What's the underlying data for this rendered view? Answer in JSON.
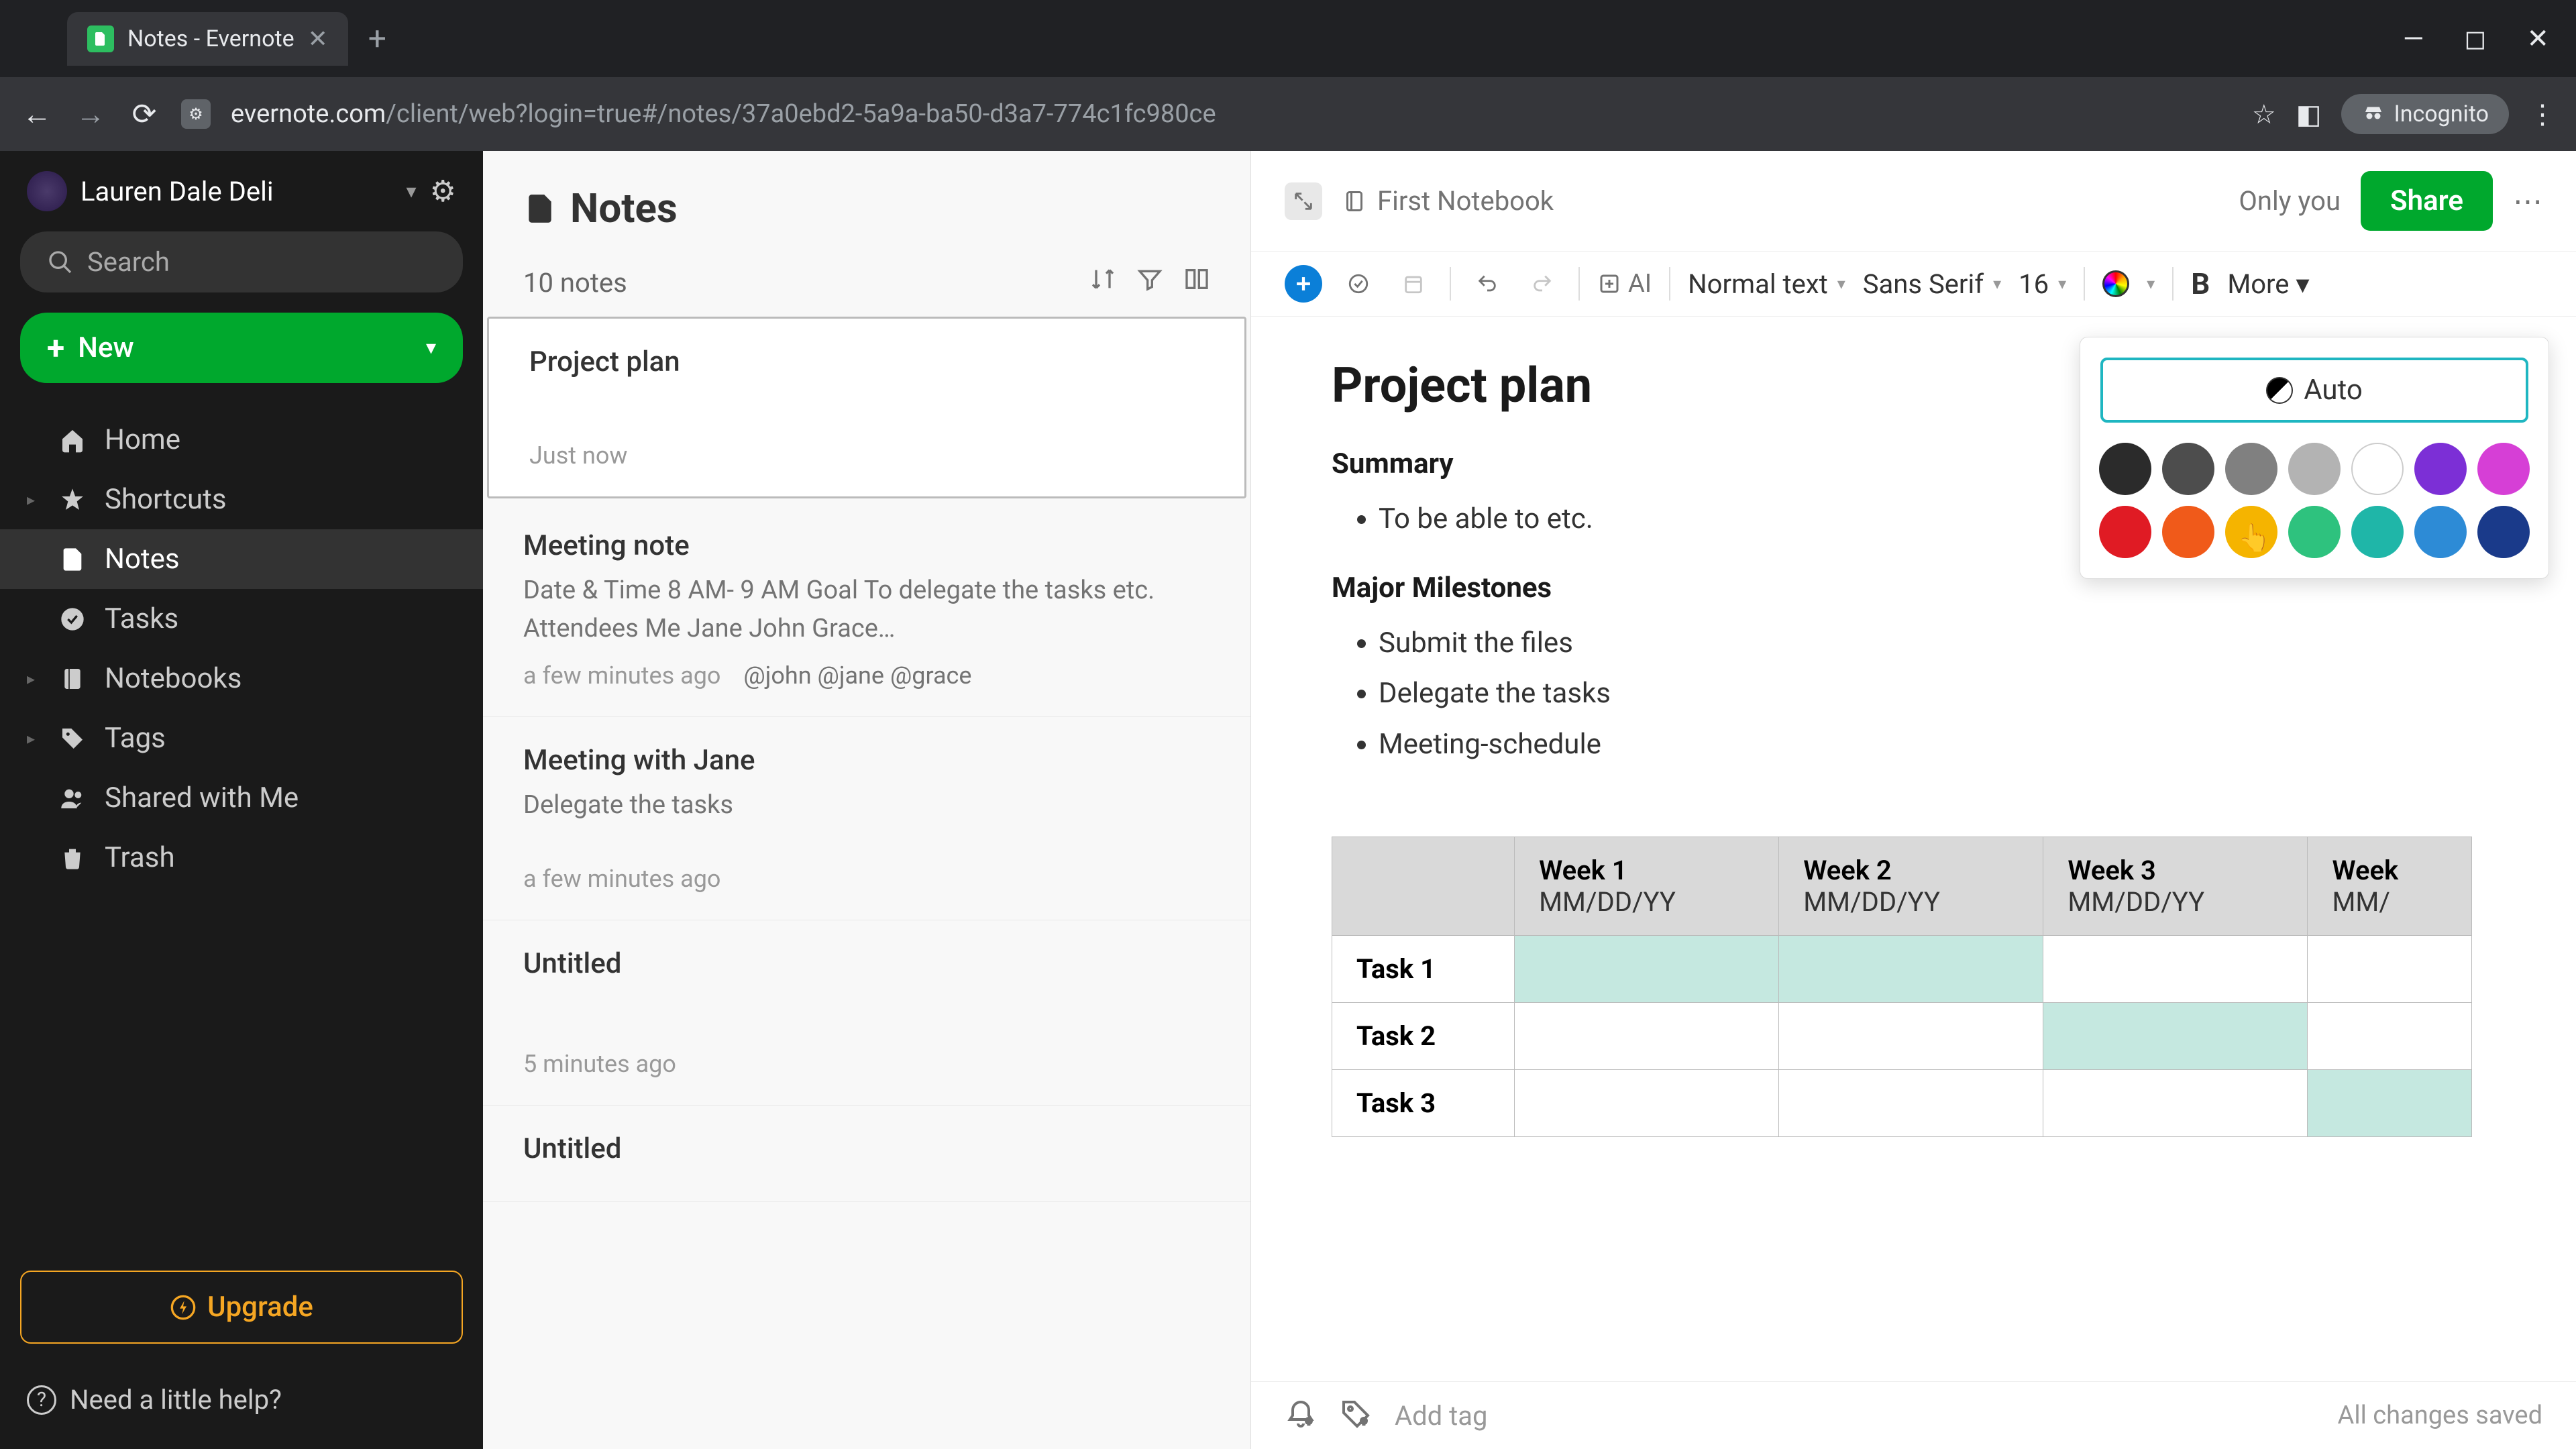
{
  "browser": {
    "tab_title": "Notes - Evernote",
    "url_domain": "evernote.com",
    "url_path": "/client/web?login=true#/notes/37a0ebd2-5a9a-ba50-d3a7-774c1fc980ce",
    "incognito_label": "Incognito"
  },
  "sidebar": {
    "account_name": "Lauren Dale Deli",
    "search_placeholder": "Search",
    "new_label": "New",
    "items": [
      {
        "label": "Home"
      },
      {
        "label": "Shortcuts"
      },
      {
        "label": "Notes"
      },
      {
        "label": "Tasks"
      },
      {
        "label": "Notebooks"
      },
      {
        "label": "Tags"
      },
      {
        "label": "Shared with Me"
      },
      {
        "label": "Trash"
      }
    ],
    "upgrade_label": "Upgrade",
    "help_label": "Need a little help?"
  },
  "note_list": {
    "title": "Notes",
    "count_label": "10 notes",
    "items": [
      {
        "title": "Project plan",
        "preview": "",
        "time": "Just now",
        "mentions": ""
      },
      {
        "title": "Meeting note",
        "preview": "Date & Time 8 AM- 9 AM Goal To delegate the tasks etc. Attendees Me Jane John Grace…",
        "time": "a few minutes ago",
        "mentions": "@john @jane @grace"
      },
      {
        "title": "Meeting with Jane",
        "preview": "Delegate the tasks",
        "time": "a few minutes ago",
        "mentions": ""
      },
      {
        "title": "Untitled",
        "preview": "",
        "time": "5 minutes ago",
        "mentions": ""
      },
      {
        "title": "Untitled",
        "preview": "",
        "time": "",
        "mentions": ""
      }
    ]
  },
  "editor": {
    "notebook_label": "First Notebook",
    "only_you_label": "Only you",
    "share_label": "Share",
    "toolbar": {
      "ai_label": "AI",
      "style_label": "Normal text",
      "font_label": "Sans Serif",
      "size_label": "16",
      "more_label": "More"
    },
    "document": {
      "title": "Project plan",
      "sections": [
        {
          "heading": "Summary",
          "bullets": [
            "To be able to etc."
          ]
        },
        {
          "heading": "Major Milestones",
          "bullets": [
            "Submit the files",
            "Delegate the tasks",
            "Meeting-schedule"
          ]
        }
      ],
      "table": {
        "headers": [
          {
            "label": "Week 1",
            "sub": "MM/DD/YY"
          },
          {
            "label": "Week 2",
            "sub": "MM/DD/YY"
          },
          {
            "label": "Week 3",
            "sub": "MM/DD/YY"
          },
          {
            "label": "Week",
            "sub": "MM/"
          }
        ],
        "rows": [
          {
            "label": "Task 1",
            "cells_teal": [
              true,
              true,
              false,
              false
            ]
          },
          {
            "label": "Task 2",
            "cells_teal": [
              false,
              false,
              true,
              false
            ]
          },
          {
            "label": "Task 3",
            "cells_teal": [
              false,
              false,
              false,
              true
            ]
          }
        ]
      }
    },
    "footer": {
      "add_tag_label": "Add tag",
      "save_status": "All changes saved"
    }
  },
  "color_picker": {
    "auto_label": "Auto",
    "colors_row1": [
      "#2b2b2b",
      "#4d4d4d",
      "#808080",
      "#b3b3b3",
      "#ffffff",
      "#7c2fd6",
      "#d63fd6"
    ],
    "colors_row2": [
      "#e01b24",
      "#f05a1a",
      "#f5b400",
      "#2ec27e",
      "#1fb6a8",
      "#2d8bd6",
      "#1a3a8a"
    ]
  }
}
